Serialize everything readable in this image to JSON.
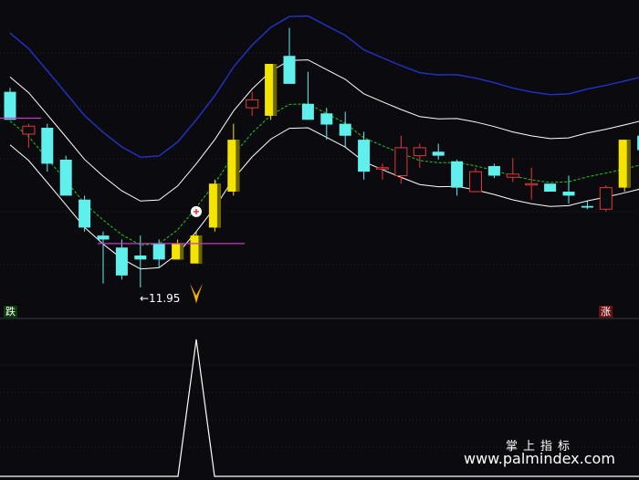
{
  "labels": {
    "fall_tag": "跌",
    "rise_tag": "涨",
    "low_marker": "←11.95",
    "watermark_cn": "掌上指标",
    "watermark_url": "www.palmindex.com"
  },
  "colors": {
    "background": "#0b0b0f",
    "up_candle": "#e0383c",
    "down_candle": "#5ff0ee",
    "signal_candle": "#f5e400",
    "upper_band": "#2233cc",
    "mid_band": "#ffffff",
    "dashed_band": "#1ecb1e",
    "support_line": "#c23cc2"
  },
  "chart_data": {
    "type": "candlestick",
    "title": "",
    "xlabel": "",
    "ylabel": "",
    "price_range": [
      11.6,
      15.6
    ],
    "low_marker_price": 11.95,
    "candles": [
      {
        "o": 14.45,
        "h": 14.5,
        "l": 14.1,
        "c": 14.1
      },
      {
        "o": 13.92,
        "h": 14.05,
        "l": 13.75,
        "c": 14.02
      },
      {
        "o": 14.0,
        "h": 14.05,
        "l": 13.45,
        "c": 13.55
      },
      {
        "o": 13.6,
        "h": 13.65,
        "l": 13.15,
        "c": 13.15
      },
      {
        "o": 13.1,
        "h": 13.15,
        "l": 12.7,
        "c": 12.75
      },
      {
        "o": 12.65,
        "h": 12.7,
        "l": 12.05,
        "c": 12.6
      },
      {
        "o": 12.5,
        "h": 12.6,
        "l": 12.1,
        "c": 12.15
      },
      {
        "o": 12.4,
        "h": 12.65,
        "l": 12.0,
        "c": 12.35
      },
      {
        "o": 12.55,
        "h": 12.6,
        "l": 12.25,
        "c": 12.35
      },
      {
        "o": 12.55,
        "h": 12.6,
        "l": 12.35,
        "c": 12.35,
        "signal": true
      },
      {
        "o": 12.65,
        "h": 12.7,
        "l": 12.3,
        "c": 12.3,
        "signal": true
      },
      {
        "o": 12.75,
        "h": 13.35,
        "l": 12.7,
        "c": 13.3,
        "signal": true
      },
      {
        "o": 13.2,
        "h": 14.05,
        "l": 13.15,
        "c": 13.85,
        "signal": true
      },
      {
        "o": 14.25,
        "h": 14.45,
        "l": 14.15,
        "c": 14.35
      },
      {
        "o": 14.15,
        "h": 14.8,
        "l": 14.1,
        "c": 14.8,
        "signal": true
      },
      {
        "o": 14.9,
        "h": 15.25,
        "l": 14.6,
        "c": 14.55
      },
      {
        "o": 14.3,
        "h": 14.7,
        "l": 14.1,
        "c": 14.1
      },
      {
        "o": 14.18,
        "h": 14.25,
        "l": 13.85,
        "c": 14.04
      },
      {
        "o": 14.05,
        "h": 14.2,
        "l": 13.75,
        "c": 13.9
      },
      {
        "o": 13.85,
        "h": 13.95,
        "l": 13.35,
        "c": 13.45
      },
      {
        "o": 13.5,
        "h": 13.55,
        "l": 13.35,
        "c": 13.5
      },
      {
        "o": 13.4,
        "h": 13.9,
        "l": 13.3,
        "c": 13.75
      },
      {
        "o": 13.65,
        "h": 13.8,
        "l": 13.5,
        "c": 13.75
      },
      {
        "o": 13.7,
        "h": 13.8,
        "l": 13.6,
        "c": 13.65
      },
      {
        "o": 13.58,
        "h": 13.6,
        "l": 13.15,
        "c": 13.25
      },
      {
        "o": 13.2,
        "h": 13.5,
        "l": 13.2,
        "c": 13.45
      },
      {
        "o": 13.52,
        "h": 13.55,
        "l": 13.37,
        "c": 13.4
      },
      {
        "o": 13.38,
        "h": 13.62,
        "l": 13.32,
        "c": 13.42
      },
      {
        "o": 13.3,
        "h": 13.5,
        "l": 13.1,
        "c": 13.3
      },
      {
        "o": 13.3,
        "h": 13.3,
        "l": 13.2,
        "c": 13.2
      },
      {
        "o": 13.2,
        "h": 13.4,
        "l": 13.05,
        "c": 13.15
      },
      {
        "o": 13.02,
        "h": 13.08,
        "l": 12.98,
        "c": 13.0
      },
      {
        "o": 12.98,
        "h": 13.28,
        "l": 12.95,
        "c": 13.25
      },
      {
        "o": 13.25,
        "h": 13.85,
        "l": 13.2,
        "c": 13.85,
        "signal": true
      },
      {
        "o": 13.9,
        "h": 14.15,
        "l": 13.65,
        "c": 13.72
      },
      {
        "o": 13.6,
        "h": 13.7,
        "l": 13.55,
        "c": 13.6
      }
    ],
    "indicator": {
      "type": "line",
      "values": [
        0,
        0,
        0,
        0,
        0,
        0,
        0,
        0,
        0,
        0,
        1,
        0,
        0,
        0,
        0,
        0,
        0,
        0,
        0,
        0,
        0,
        0,
        0,
        0,
        0,
        0,
        0,
        0,
        0,
        0,
        0,
        0,
        0,
        0,
        0,
        0
      ]
    }
  }
}
